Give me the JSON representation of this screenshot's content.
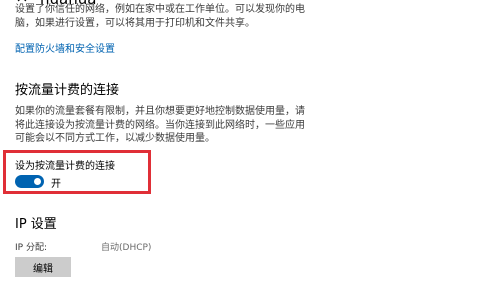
{
  "network": {
    "name": "huahua",
    "icon": "wifi-icon"
  },
  "intro": {
    "lines": [
      "设置了你信任的网络，例如在家中或在工作单位。可以发现你的电",
      "脑，如果进行设置，可以将其用于打印机和文件共享。"
    ]
  },
  "firewall_link": "配置防火墙和安全设置",
  "metered": {
    "title": "按流量计费的连接",
    "description_lines": [
      "如果你的流量套餐有限制，并且你想要更好地控制数据使用量，请",
      "将此连接设为按流量计费的网络。当你连接到此网络时，一些应用",
      "可能会以不同方式工作，以减少数据使用量。"
    ],
    "toggle_label": "设为按流量计费的连接",
    "toggle_state": "开",
    "toggle_on": true,
    "highlight_color": "#e02f37",
    "toggle_color": "#0063b1"
  },
  "ip": {
    "title": "IP 设置",
    "assignment_label": "IP 分配:",
    "assignment_value": "自动(DHCP)",
    "edit_label": "编辑"
  }
}
